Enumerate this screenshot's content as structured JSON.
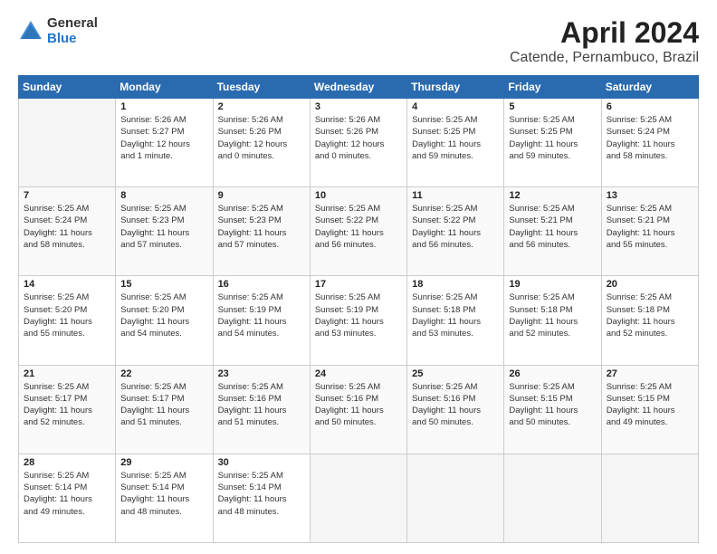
{
  "header": {
    "logo_general": "General",
    "logo_blue": "Blue",
    "title": "April 2024",
    "subtitle": "Catende, Pernambuco, Brazil"
  },
  "columns": [
    "Sunday",
    "Monday",
    "Tuesday",
    "Wednesday",
    "Thursday",
    "Friday",
    "Saturday"
  ],
  "weeks": [
    [
      {
        "num": "",
        "detail": ""
      },
      {
        "num": "1",
        "detail": "Sunrise: 5:26 AM\nSunset: 5:27 PM\nDaylight: 12 hours\nand 1 minute."
      },
      {
        "num": "2",
        "detail": "Sunrise: 5:26 AM\nSunset: 5:26 PM\nDaylight: 12 hours\nand 0 minutes."
      },
      {
        "num": "3",
        "detail": "Sunrise: 5:26 AM\nSunset: 5:26 PM\nDaylight: 12 hours\nand 0 minutes."
      },
      {
        "num": "4",
        "detail": "Sunrise: 5:25 AM\nSunset: 5:25 PM\nDaylight: 11 hours\nand 59 minutes."
      },
      {
        "num": "5",
        "detail": "Sunrise: 5:25 AM\nSunset: 5:25 PM\nDaylight: 11 hours\nand 59 minutes."
      },
      {
        "num": "6",
        "detail": "Sunrise: 5:25 AM\nSunset: 5:24 PM\nDaylight: 11 hours\nand 58 minutes."
      }
    ],
    [
      {
        "num": "7",
        "detail": "Sunrise: 5:25 AM\nSunset: 5:24 PM\nDaylight: 11 hours\nand 58 minutes."
      },
      {
        "num": "8",
        "detail": "Sunrise: 5:25 AM\nSunset: 5:23 PM\nDaylight: 11 hours\nand 57 minutes."
      },
      {
        "num": "9",
        "detail": "Sunrise: 5:25 AM\nSunset: 5:23 PM\nDaylight: 11 hours\nand 57 minutes."
      },
      {
        "num": "10",
        "detail": "Sunrise: 5:25 AM\nSunset: 5:22 PM\nDaylight: 11 hours\nand 56 minutes."
      },
      {
        "num": "11",
        "detail": "Sunrise: 5:25 AM\nSunset: 5:22 PM\nDaylight: 11 hours\nand 56 minutes."
      },
      {
        "num": "12",
        "detail": "Sunrise: 5:25 AM\nSunset: 5:21 PM\nDaylight: 11 hours\nand 56 minutes."
      },
      {
        "num": "13",
        "detail": "Sunrise: 5:25 AM\nSunset: 5:21 PM\nDaylight: 11 hours\nand 55 minutes."
      }
    ],
    [
      {
        "num": "14",
        "detail": "Sunrise: 5:25 AM\nSunset: 5:20 PM\nDaylight: 11 hours\nand 55 minutes."
      },
      {
        "num": "15",
        "detail": "Sunrise: 5:25 AM\nSunset: 5:20 PM\nDaylight: 11 hours\nand 54 minutes."
      },
      {
        "num": "16",
        "detail": "Sunrise: 5:25 AM\nSunset: 5:19 PM\nDaylight: 11 hours\nand 54 minutes."
      },
      {
        "num": "17",
        "detail": "Sunrise: 5:25 AM\nSunset: 5:19 PM\nDaylight: 11 hours\nand 53 minutes."
      },
      {
        "num": "18",
        "detail": "Sunrise: 5:25 AM\nSunset: 5:18 PM\nDaylight: 11 hours\nand 53 minutes."
      },
      {
        "num": "19",
        "detail": "Sunrise: 5:25 AM\nSunset: 5:18 PM\nDaylight: 11 hours\nand 52 minutes."
      },
      {
        "num": "20",
        "detail": "Sunrise: 5:25 AM\nSunset: 5:18 PM\nDaylight: 11 hours\nand 52 minutes."
      }
    ],
    [
      {
        "num": "21",
        "detail": "Sunrise: 5:25 AM\nSunset: 5:17 PM\nDaylight: 11 hours\nand 52 minutes."
      },
      {
        "num": "22",
        "detail": "Sunrise: 5:25 AM\nSunset: 5:17 PM\nDaylight: 11 hours\nand 51 minutes."
      },
      {
        "num": "23",
        "detail": "Sunrise: 5:25 AM\nSunset: 5:16 PM\nDaylight: 11 hours\nand 51 minutes."
      },
      {
        "num": "24",
        "detail": "Sunrise: 5:25 AM\nSunset: 5:16 PM\nDaylight: 11 hours\nand 50 minutes."
      },
      {
        "num": "25",
        "detail": "Sunrise: 5:25 AM\nSunset: 5:16 PM\nDaylight: 11 hours\nand 50 minutes."
      },
      {
        "num": "26",
        "detail": "Sunrise: 5:25 AM\nSunset: 5:15 PM\nDaylight: 11 hours\nand 50 minutes."
      },
      {
        "num": "27",
        "detail": "Sunrise: 5:25 AM\nSunset: 5:15 PM\nDaylight: 11 hours\nand 49 minutes."
      }
    ],
    [
      {
        "num": "28",
        "detail": "Sunrise: 5:25 AM\nSunset: 5:14 PM\nDaylight: 11 hours\nand 49 minutes."
      },
      {
        "num": "29",
        "detail": "Sunrise: 5:25 AM\nSunset: 5:14 PM\nDaylight: 11 hours\nand 48 minutes."
      },
      {
        "num": "30",
        "detail": "Sunrise: 5:25 AM\nSunset: 5:14 PM\nDaylight: 11 hours\nand 48 minutes."
      },
      {
        "num": "",
        "detail": ""
      },
      {
        "num": "",
        "detail": ""
      },
      {
        "num": "",
        "detail": ""
      },
      {
        "num": "",
        "detail": ""
      }
    ]
  ]
}
